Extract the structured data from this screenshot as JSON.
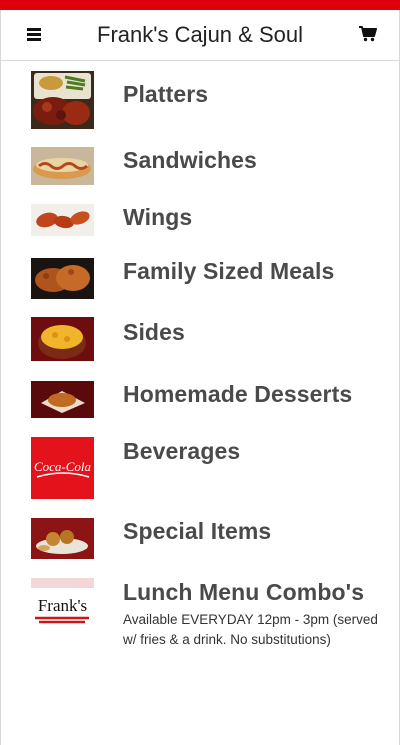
{
  "header": {
    "title": "Frank's Cajun & Soul"
  },
  "menu": {
    "items": [
      {
        "label": "Platters",
        "image": "platter-photo"
      },
      {
        "label": "Sandwiches",
        "image": "sandwich-photo"
      },
      {
        "label": "Wings",
        "image": "wings-photo"
      },
      {
        "label": "Family Sized Meals",
        "image": "fried-chicken-photo"
      },
      {
        "label": "Sides",
        "image": "mac-and-cheese-photo"
      },
      {
        "label": "Homemade Desserts",
        "image": "dessert-photo"
      },
      {
        "label": "Beverages",
        "image": "coca-cola-logo",
        "logo_text": "Coca-Cola"
      },
      {
        "label": "Special Items",
        "image": "special-items-photo"
      },
      {
        "label": "Lunch Menu Combo's",
        "image": "franks-logo",
        "logo_text": "Frank's",
        "description": "Available EVERYDAY 12pm - 3pm (served w/ fries & a drink. No substitutions)"
      }
    ]
  },
  "colors": {
    "brand_red": "#e0000b",
    "label_gray": "#4a4a4a"
  }
}
